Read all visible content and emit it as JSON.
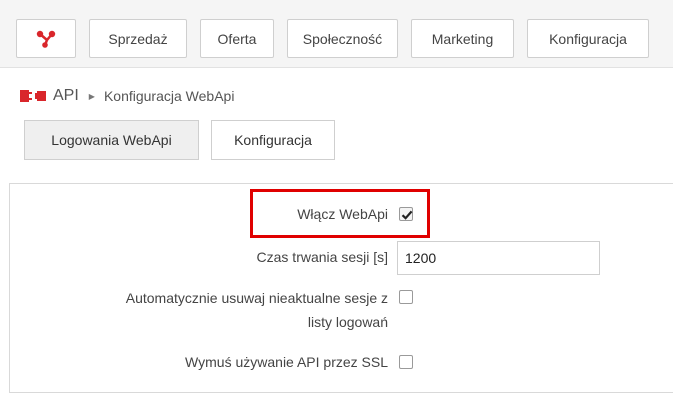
{
  "nav": {
    "items": [
      {
        "label": "Sprzedaż"
      },
      {
        "label": "Oferta"
      },
      {
        "label": "Społeczność"
      },
      {
        "label": "Marketing"
      },
      {
        "label": "Konfiguracja"
      }
    ],
    "logo_icon": "share-network-icon",
    "logo_color": "#d9262b"
  },
  "breadcrumb": {
    "icon": "api-plug-icon",
    "root": "API",
    "separator_icon": "triangle-right-icon",
    "current": "Konfiguracja WebApi"
  },
  "tabs": [
    {
      "label": "Logowania WebApi",
      "active": false
    },
    {
      "label": "Konfiguracja",
      "active": true
    }
  ],
  "form": {
    "enable_webapi": {
      "label": "Włącz WebApi",
      "checked": true
    },
    "session_duration": {
      "label": "Czas trwania sesji [s]",
      "value": "1200"
    },
    "auto_remove": {
      "label_line1": "Automatycznie usuwaj nieaktualne sesje z",
      "label_line2": "listy logowań",
      "checked": false
    },
    "force_ssl": {
      "label": "Wymuś używanie API przez SSL",
      "checked": false
    }
  },
  "highlight_color": "#e00000"
}
